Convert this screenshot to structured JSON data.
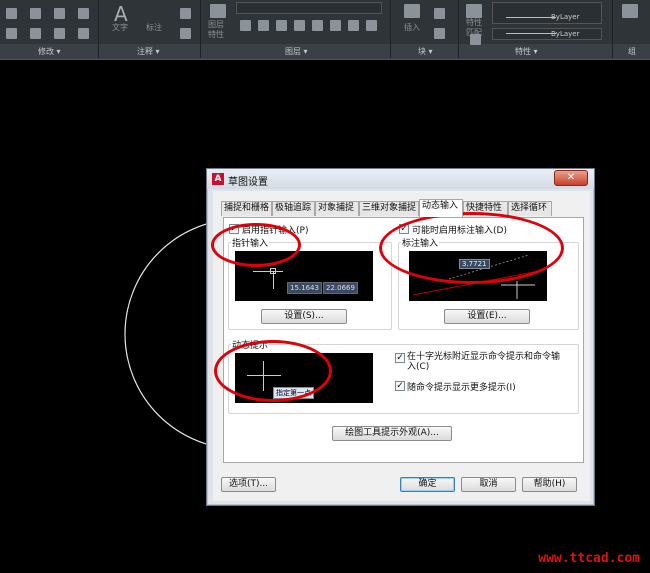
{
  "ribbon": {
    "panels": [
      "修改 ▾",
      "注释 ▾",
      "图层 ▾",
      "块 ▾",
      "特性 ▾",
      "组"
    ],
    "text_btn": "文字",
    "dim_btn": "标注",
    "layer_btn": "图层\n特性",
    "insert_btn": "插入",
    "match_btn": "特性\n匹配",
    "bylayer1": "ByLayer",
    "bylayer2": "ByLayer"
  },
  "dialog": {
    "title": "草图设置",
    "tabs": [
      "捕捉和栅格",
      "极轴追踪",
      "对象捕捉",
      "三维对象捕捉",
      "动态输入",
      "快捷特性",
      "选择循环"
    ],
    "pointer": {
      "enable_label": "启用指针输入(P)",
      "group_title": "指针输入",
      "coord_x": "15.1643",
      "coord_y": "22.0669",
      "settings_label": "设置(S)..."
    },
    "dim": {
      "enable_label": "可能时启用标注输入(D)",
      "group_title": "标注输入",
      "dim_value": "3.7721",
      "settings_label": "设置(E)..."
    },
    "prompt": {
      "group_title": "动态提示",
      "preview_text": "指定第一点",
      "cb1_label": "在十字光标附近显示命令提示和命令输入(C)",
      "cb2_label": "随命令提示显示更多提示(I)"
    },
    "appearance_label": "绘图工具提示外观(A)...",
    "options_label": "选项(T)...",
    "ok_label": "确定",
    "cancel_label": "取消",
    "help_label": "帮助(H)"
  },
  "watermark": "www.ttcad.com"
}
